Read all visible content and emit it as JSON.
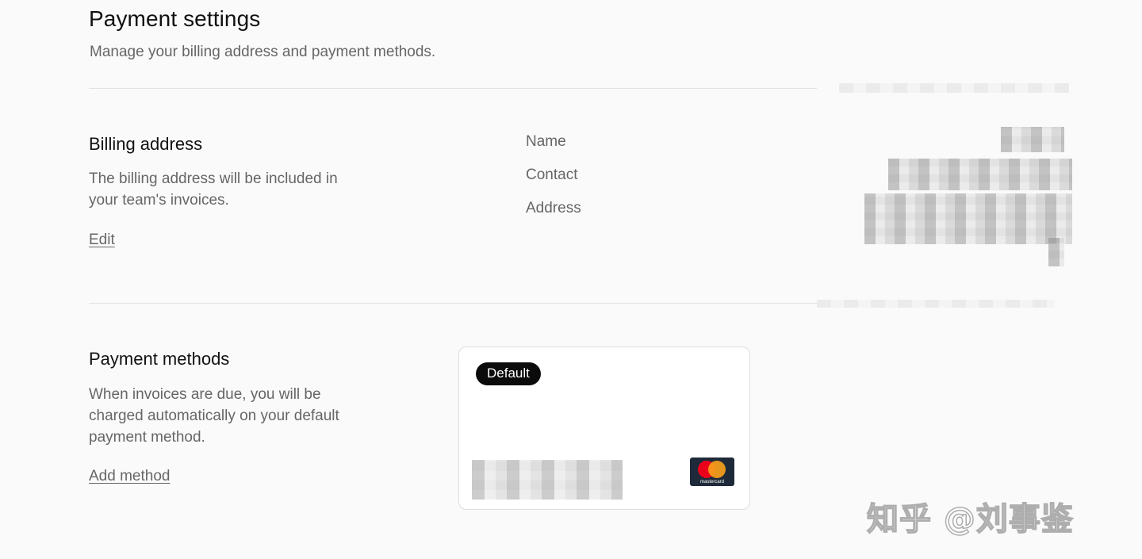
{
  "header": {
    "title": "Payment settings",
    "subtitle": "Manage your billing address and payment methods."
  },
  "billing": {
    "title": "Billing address",
    "description": "The billing address will be included in your team's invoices.",
    "edit_label": "Edit",
    "fields": {
      "name_label": "Name",
      "contact_label": "Contact",
      "address_label": "Address"
    }
  },
  "payment": {
    "title": "Payment methods",
    "description": "When invoices are due, you will be charged automatically on your default payment method.",
    "add_label": "Add method",
    "card": {
      "badge": "Default",
      "brand": "mastercard",
      "brand_icon": "mastercard-icon"
    }
  },
  "watermark": "知乎 @刘事鉴"
}
